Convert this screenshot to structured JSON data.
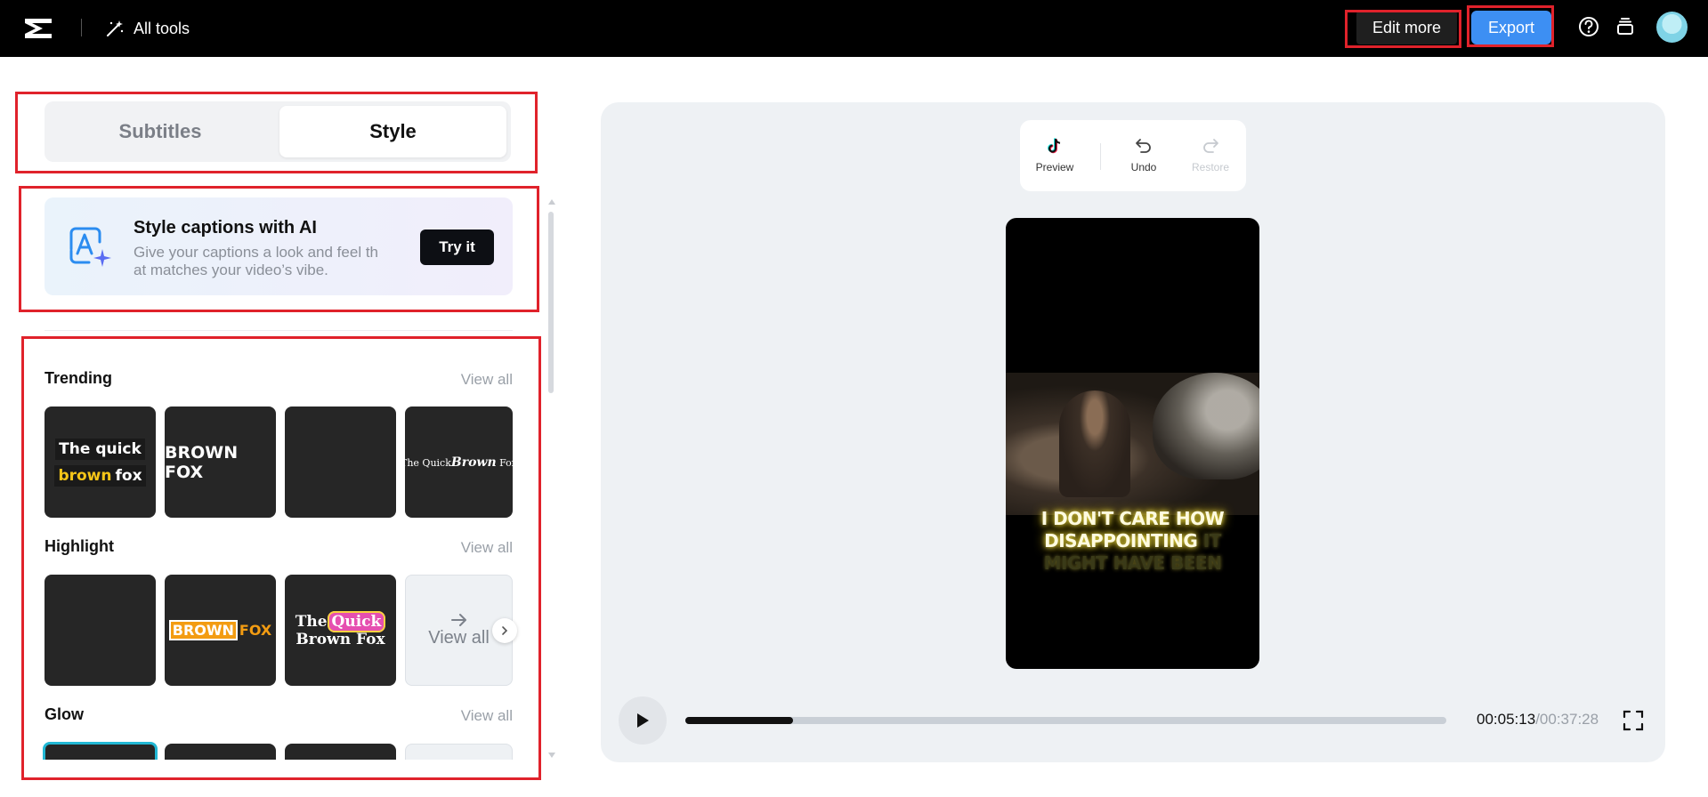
{
  "topbar": {
    "all_tools_label": "All tools",
    "edit_more_label": "Edit more",
    "export_label": "Export",
    "icons": [
      "capcut-logo-icon",
      "magic-wand-icon",
      "help-icon",
      "layers-icon",
      "avatar"
    ]
  },
  "tabs": {
    "subtitles": "Subtitles",
    "style": "Style",
    "active": "Style"
  },
  "ai_card": {
    "title": "Style captions with AI",
    "description": "Give your captions a look and feel that matches your video's vibe.",
    "description_line1": "Give your captions a look and feel th",
    "description_line2": "at matches your video’s vibe.",
    "button": "Try it"
  },
  "sections": {
    "trending": {
      "title": "Trending",
      "view_all": "View all",
      "tile1_line1": "The quick",
      "tile1_line2a": "brown",
      "tile1_line2b": "fox",
      "tile2": "BROWN FOX",
      "tile4_a": "The Quick",
      "tile4_b": "Brown",
      "tile4_c": "Fox"
    },
    "highlight": {
      "title": "Highlight",
      "view_all": "View all",
      "tile2_a": "BROWN",
      "tile2_b": "FOX",
      "tile3_a": "The",
      "tile3_b": "Quick",
      "tile3_c": "Brown Fox",
      "view_tile": "View all"
    },
    "glow": {
      "title": "Glow",
      "view_all": "View all"
    }
  },
  "toolbar": {
    "preview": "Preview",
    "undo": "Undo",
    "restore": "Restore"
  },
  "video": {
    "caption_line1": "I DON'T CARE HOW",
    "caption_line2_on": "DISAPPOINTING",
    "caption_line2_off": "IT",
    "caption_line3": "MIGHT HAVE BEEN"
  },
  "player": {
    "current_time": "00:05:13",
    "total_time": "/00:37:28",
    "progress_fraction": 0.142
  },
  "colors": {
    "accent": "#3d8ff3",
    "highlight_box": "#e0222b",
    "glow": "#f1e24a"
  }
}
